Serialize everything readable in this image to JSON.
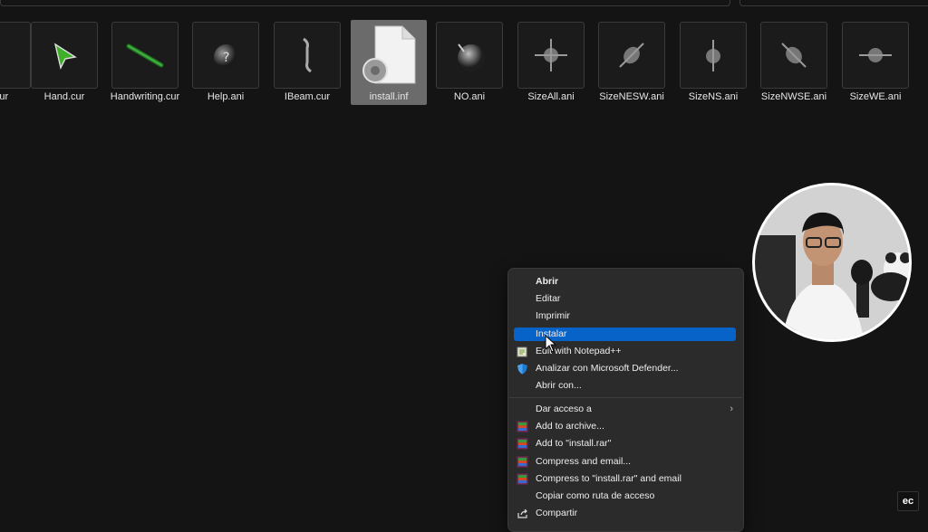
{
  "files": [
    {
      "name": "...cur",
      "icon": "partial-cursor-icon"
    },
    {
      "name": "Hand.cur",
      "icon": "hand-cursor-icon"
    },
    {
      "name": "Handwriting.cur",
      "icon": "handwriting-cursor-icon"
    },
    {
      "name": "Help.ani",
      "icon": "help-cursor-icon"
    },
    {
      "name": "IBeam.cur",
      "icon": "ibeam-cursor-icon"
    },
    {
      "name": "install.inf",
      "icon": "setup-file-icon",
      "selected": true
    },
    {
      "name": "NO.ani",
      "icon": "no-cursor-icon"
    },
    {
      "name": "SizeAll.ani",
      "icon": "sizeall-cursor-icon"
    },
    {
      "name": "SizeNESW.ani",
      "icon": "sizenesw-cursor-icon"
    },
    {
      "name": "SizeNS.ani",
      "icon": "sizens-cursor-icon"
    },
    {
      "name": "SizeNWSE.ani",
      "icon": "sizenwse-cursor-icon"
    },
    {
      "name": "SizeWE.ani",
      "icon": "sizewe-cursor-icon"
    }
  ],
  "context_menu": {
    "items": [
      {
        "label": "Abrir",
        "bold": true
      },
      {
        "label": "Editar"
      },
      {
        "label": "Imprimir"
      },
      {
        "label": "Instalar",
        "highlighted": true
      },
      {
        "label": "Edit with Notepad++",
        "icon": "notepadpp-icon"
      },
      {
        "label": "Analizar con Microsoft Defender...",
        "icon": "defender-shield-icon"
      },
      {
        "label": "Abrir con..."
      },
      {
        "label": "Dar acceso a",
        "submenu": true
      },
      {
        "label": "Add to archive...",
        "icon": "winrar-icon"
      },
      {
        "label": "Add to \"install.rar\"",
        "icon": "winrar-icon"
      },
      {
        "label": "Compress and email...",
        "icon": "winrar-icon"
      },
      {
        "label": "Compress to \"install.rar\" and email",
        "icon": "winrar-icon"
      },
      {
        "label": "Copiar como ruta de acceso"
      },
      {
        "label": "Compartir",
        "icon": "share-icon"
      }
    ]
  },
  "watermark": "ec",
  "colors": {
    "highlight": "#0863c9",
    "background": "#141414",
    "menu_bg": "#2b2b2b"
  }
}
